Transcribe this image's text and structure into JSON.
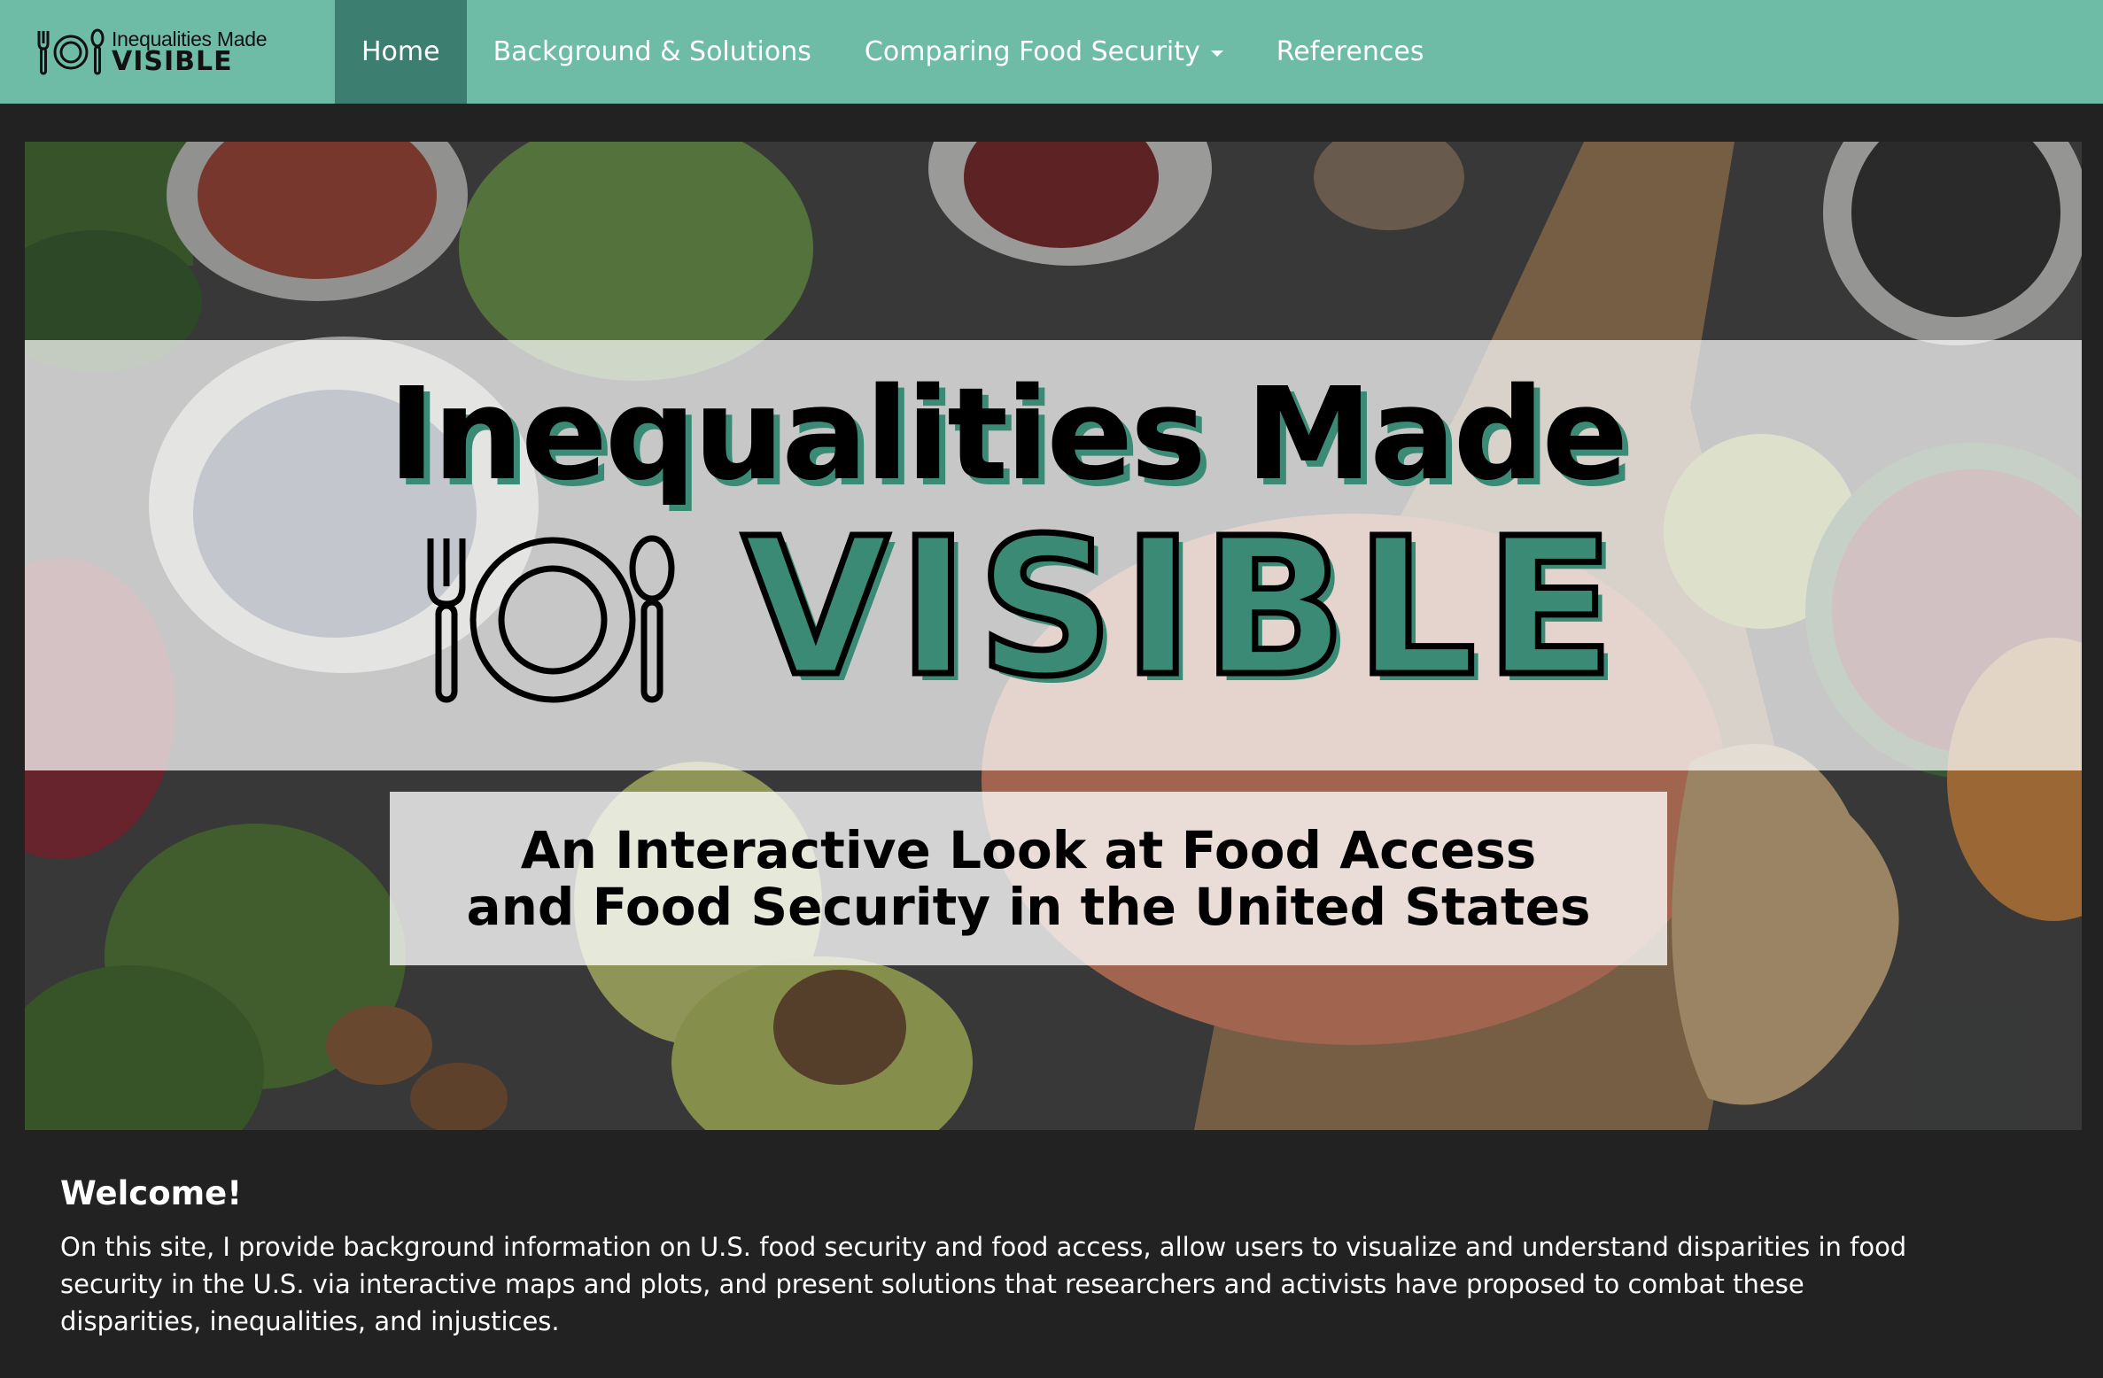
{
  "brand": {
    "small": "Inequalities Made",
    "big": "VISIBLE"
  },
  "nav": {
    "items": [
      {
        "label": "Home",
        "active": true
      },
      {
        "label": "Background & Solutions",
        "active": false
      },
      {
        "label": "Comparing Food Security",
        "active": false,
        "dropdown": true
      },
      {
        "label": "References",
        "active": false
      }
    ]
  },
  "hero": {
    "title_line1": "Inequalities Made",
    "title_line2": "VISIBLE",
    "subtitle_line1": "An Interactive Look at Food Access",
    "subtitle_line2": "and Food Security in the United States",
    "icon": "fork-plate-spoon-icon",
    "background": "vegetables-photo"
  },
  "welcome": {
    "title": "Welcome!",
    "text": "On this site, I provide background information on U.S. food security and food access, allow users to visualize and understand disparities in food security in the U.S. via interactive maps and plots, and present solutions that researchers and activists have proposed to combat these disparities, inequalities, and injustices."
  },
  "colors": {
    "navbar": "#6fbca6",
    "nav_active": "#3c7f70",
    "page_bg": "#222222",
    "accent_teal": "#3a8a76"
  }
}
